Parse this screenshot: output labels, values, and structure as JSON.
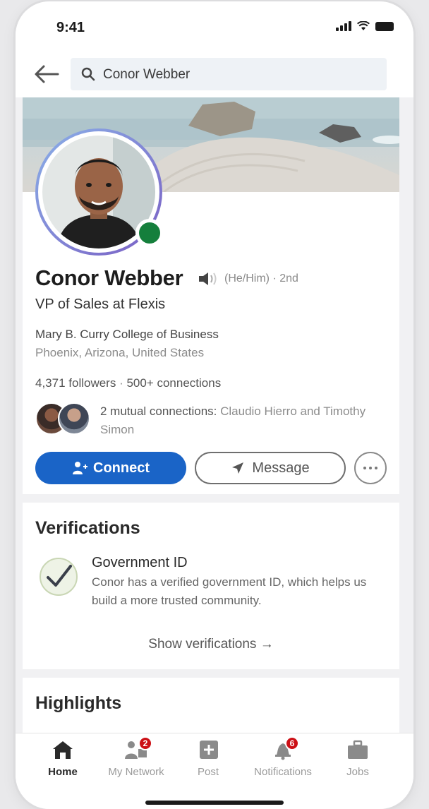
{
  "status_bar": {
    "time": "9:41"
  },
  "search": {
    "query": "Conor Webber"
  },
  "profile": {
    "name": "Conor Webber",
    "pronouns": "(He/Him) · 2nd",
    "headline": "VP of Sales at Flexis",
    "school": "Mary B. Curry College of Business",
    "location": "Phoenix, Arizona, United States",
    "followers": "4,371 followers",
    "separator": " · ",
    "connections": "500+ connections",
    "mutual_prefix": "2 mutual connections:",
    "mutual_names": " Claudio Hierro and Timothy Simon",
    "online_color": "#157f3c"
  },
  "actions": {
    "connect_label": "Connect",
    "message_label": "Message",
    "connect_color": "#1a64c7"
  },
  "verifications": {
    "title": "Verifications",
    "item_title": "Government ID",
    "item_desc": "Conor has a verified government ID, which helps us build a more trusted community.",
    "show_link": "Show verifications →"
  },
  "highlights": {
    "title": "Highlights"
  },
  "bottom_nav": {
    "items": [
      {
        "label": "Home",
        "icon": "home-icon"
      },
      {
        "label": "My Network",
        "icon": "network-icon",
        "badge": "2"
      },
      {
        "label": "Post",
        "icon": "post-icon"
      },
      {
        "label": "Notifications",
        "icon": "bell-icon",
        "badge": "6"
      },
      {
        "label": "Jobs",
        "icon": "briefcase-icon"
      }
    ]
  }
}
